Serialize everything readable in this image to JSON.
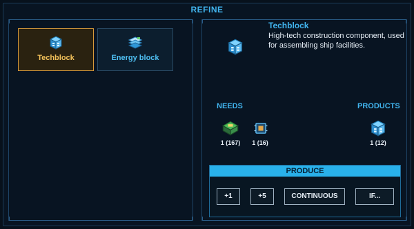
{
  "window": {
    "title": "REFINE"
  },
  "recipes": [
    {
      "label": "Techblock",
      "selected": true,
      "icon": "techblock-icon"
    },
    {
      "label": "Energy block",
      "selected": false,
      "icon": "energy-block-icon"
    }
  ],
  "item": {
    "name": "Techblock",
    "description": "High-tech construction component, used for assembling ship facilities.",
    "icon": "techblock-icon"
  },
  "needs": {
    "label": "NEEDS",
    "items": [
      {
        "icon": "circuit-board-icon",
        "count": "1 (167)"
      },
      {
        "icon": "chip-icon",
        "count": "1 (16)"
      }
    ]
  },
  "products": {
    "label": "PRODUCTS",
    "items": [
      {
        "icon": "techblock-icon",
        "count": "1 (12)"
      }
    ]
  },
  "produce": {
    "label": "PRODUCE",
    "buttons": [
      "+1",
      "+5",
      "CONTINUOUS",
      "IF..."
    ]
  },
  "colors": {
    "accent": "#41b4ee",
    "selected_border": "#d79a3a",
    "selected_text": "#f2c15a",
    "produce_header": "#29b1ea"
  }
}
